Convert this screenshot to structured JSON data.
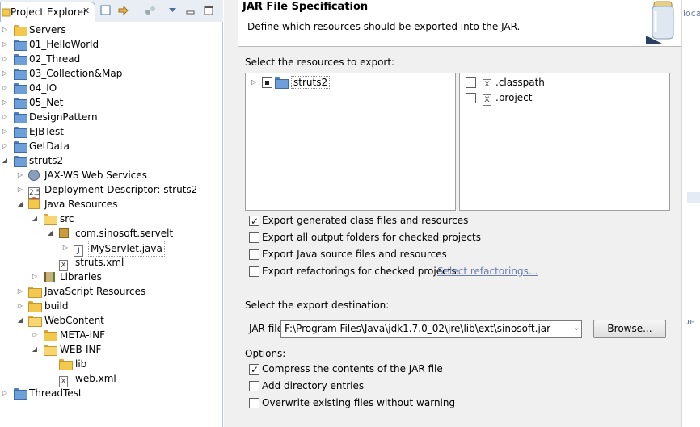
{
  "explorer": {
    "tab_label": "Project Explorer",
    "items": [
      {
        "label": "Servers"
      },
      {
        "label": "01_HelloWorld"
      },
      {
        "label": "02_Thread"
      },
      {
        "label": "03_Collection&Map"
      },
      {
        "label": "04_IO"
      },
      {
        "label": "05_Net"
      },
      {
        "label": "DesignPattern"
      },
      {
        "label": "EJBTest"
      },
      {
        "label": "GetData"
      },
      {
        "label": "struts2"
      },
      {
        "label": "JAX-WS Web Services"
      },
      {
        "label": "Deployment Descriptor: struts2"
      },
      {
        "label": "Java Resources"
      },
      {
        "label": "src"
      },
      {
        "label": "com.sinosoft.servelt"
      },
      {
        "label": "MyServlet.java"
      },
      {
        "label": "struts.xml"
      },
      {
        "label": "Libraries"
      },
      {
        "label": "JavaScript Resources"
      },
      {
        "label": "build"
      },
      {
        "label": "WebContent"
      },
      {
        "label": "META-INF"
      },
      {
        "label": "WEB-INF"
      },
      {
        "label": "lib"
      },
      {
        "label": "web.xml"
      },
      {
        "label": "ThreadTest"
      }
    ]
  },
  "dialog": {
    "title": "JAR File Specification",
    "description": "Define which resources should be exported into the JAR.",
    "resources_label": "Select the resources to export:",
    "tree_items": [
      {
        "label": "struts2"
      }
    ],
    "file_items": [
      {
        "label": ".classpath",
        "checked": false
      },
      {
        "label": ".project",
        "checked": false
      }
    ],
    "export_options": [
      {
        "label": "Export generated class files and resources",
        "checked": true
      },
      {
        "label": "Export all output folders for checked projects",
        "checked": false
      },
      {
        "label": "Export Java source files and resources",
        "checked": false
      },
      {
        "label": "Export refactorings for checked projects.",
        "checked": false
      }
    ],
    "select_refactorings_link": "Select refactorings...",
    "destination_label": "Select the export destination:",
    "jar_file_label": "JAR file:",
    "jar_file_value": "F:\\Program Files\\Java\\jdk1.7.0_02\\jre\\lib\\ext\\sinosoft.jar",
    "browse_label": "Browse...",
    "options_label": "Options:",
    "options": [
      {
        "label": "Compress the contents of the JAR file",
        "checked": true
      },
      {
        "label": "Add directory entries",
        "checked": false
      },
      {
        "label": "Overwrite existing files without warning",
        "checked": false
      }
    ]
  },
  "background_editor": {
    "fragment_1": "loca",
    "fragment_2": "ue"
  }
}
